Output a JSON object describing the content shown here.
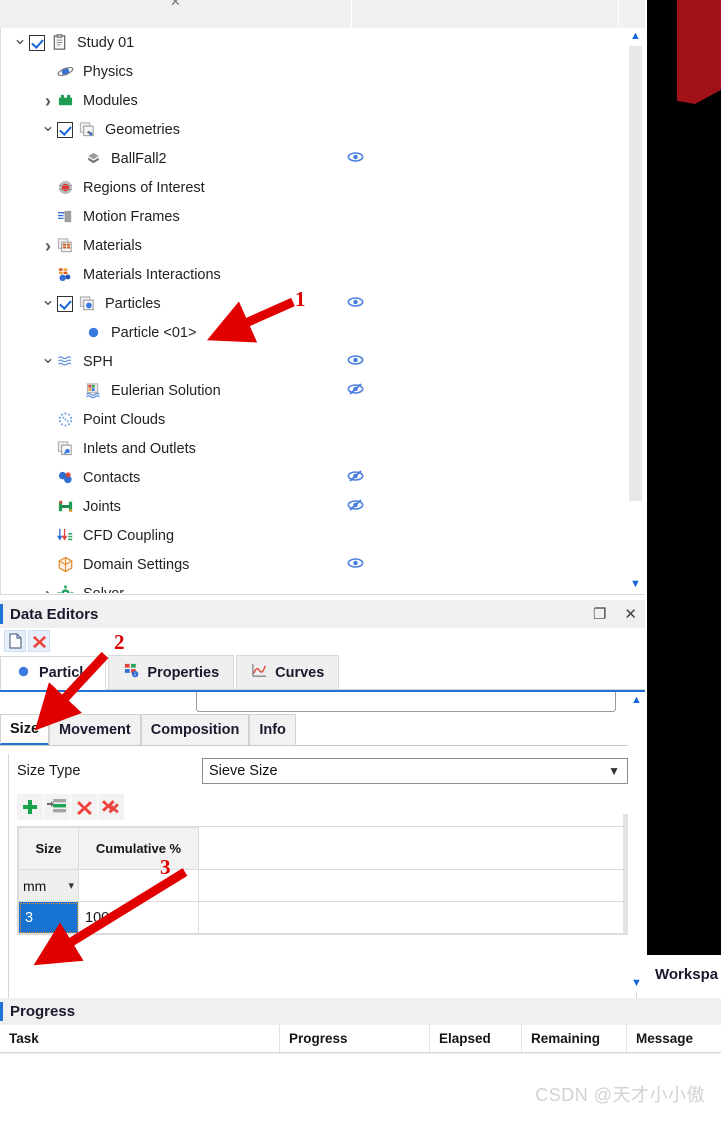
{
  "window": {
    "tab_close_icon": "close-icon"
  },
  "tree": {
    "items": [
      {
        "label": "Study 01",
        "indent": 0,
        "chevron": "down",
        "checkbox": "checked",
        "icon": "clipboard-icon",
        "eye": "none"
      },
      {
        "label": "Physics",
        "indent": 1,
        "chevron": "none",
        "checkbox": "none",
        "icon": "physics-orbit-icon",
        "eye": "none"
      },
      {
        "label": "Modules",
        "indent": 1,
        "chevron": "right",
        "checkbox": "none",
        "icon": "modules-brick-icon",
        "eye": "none"
      },
      {
        "label": "Geometries",
        "indent": 1,
        "chevron": "down",
        "checkbox": "checked",
        "icon": "geometries-icon",
        "eye": "none"
      },
      {
        "label": "BallFall2",
        "indent": 2,
        "chevron": "none",
        "checkbox": "none",
        "icon": "geometry-object-icon",
        "eye": "visible"
      },
      {
        "label": "Regions of Interest",
        "indent": 1,
        "chevron": "none",
        "checkbox": "none",
        "icon": "region-sphere-icon",
        "eye": "none"
      },
      {
        "label": "Motion Frames",
        "indent": 1,
        "chevron": "none",
        "checkbox": "none",
        "icon": "motion-frame-icon",
        "eye": "none"
      },
      {
        "label": "Materials",
        "indent": 1,
        "chevron": "right",
        "checkbox": "none",
        "icon": "materials-icon",
        "eye": "none"
      },
      {
        "label": "Materials Interactions",
        "indent": 1,
        "chevron": "none",
        "checkbox": "none",
        "icon": "materials-interactions-icon",
        "eye": "none"
      },
      {
        "label": "Particles",
        "indent": 1,
        "chevron": "down",
        "checkbox": "checked",
        "icon": "particles-icon",
        "eye": "visible"
      },
      {
        "label": "Particle <01>",
        "indent": 2,
        "chevron": "none",
        "checkbox": "none",
        "icon": "particle-dot-icon",
        "eye": "none"
      },
      {
        "label": "SPH",
        "indent": 1,
        "chevron": "down",
        "checkbox": "none",
        "icon": "sph-waves-icon",
        "eye": "visible"
      },
      {
        "label": "Eulerian Solution",
        "indent": 2,
        "chevron": "none",
        "checkbox": "none",
        "icon": "eulerian-solution-icon",
        "eye": "hidden"
      },
      {
        "label": "Point Clouds",
        "indent": 1,
        "chevron": "none",
        "checkbox": "none",
        "icon": "point-cloud-icon",
        "eye": "none"
      },
      {
        "label": "Inlets and Outlets",
        "indent": 1,
        "chevron": "none",
        "checkbox": "none",
        "icon": "inlets-outlets-icon",
        "eye": "none"
      },
      {
        "label": "Contacts",
        "indent": 1,
        "chevron": "none",
        "checkbox": "none",
        "icon": "contacts-icon",
        "eye": "hidden"
      },
      {
        "label": "Joints",
        "indent": 1,
        "chevron": "none",
        "checkbox": "none",
        "icon": "joints-icon",
        "eye": "hidden"
      },
      {
        "label": "CFD Coupling",
        "indent": 1,
        "chevron": "none",
        "checkbox": "none",
        "icon": "cfd-coupling-icon",
        "eye": "none"
      },
      {
        "label": "Domain Settings",
        "indent": 1,
        "chevron": "none",
        "checkbox": "none",
        "icon": "domain-settings-icon",
        "eye": "visible"
      },
      {
        "label": "Solver",
        "indent": 1,
        "chevron": "right",
        "checkbox": "none",
        "icon": "solver-gear-icon",
        "eye": "none"
      }
    ]
  },
  "data_editors": {
    "title": "Data Editors",
    "restore_icon": "restore-window-icon",
    "close_icon": "close-icon",
    "toolbar": [
      {
        "name": "new-document-button",
        "icon": "document-icon"
      },
      {
        "name": "delete-button",
        "icon": "red-x-icon"
      }
    ],
    "tabs": [
      {
        "label": "Particle",
        "icon": "particle-dot-icon",
        "active": true
      },
      {
        "label": "Properties",
        "icon": "properties-grid-icon",
        "active": false
      },
      {
        "label": "Curves",
        "icon": "curve-chart-icon",
        "active": false
      }
    ],
    "sub_tabs": [
      {
        "label": "Size",
        "active": true
      },
      {
        "label": "Movement",
        "active": false
      },
      {
        "label": "Composition",
        "active": false
      },
      {
        "label": "Info",
        "active": false
      }
    ],
    "size_type": {
      "label": "Size Type",
      "value": "Sieve Size"
    },
    "grid_tools": [
      {
        "name": "add-row-button",
        "icon": "green-plus-icon"
      },
      {
        "name": "insert-row-button",
        "icon": "insert-rows-icon"
      },
      {
        "name": "delete-row-button",
        "icon": "red-x-icon"
      },
      {
        "name": "delete-all-rows-button",
        "icon": "red-double-x-icon"
      }
    ],
    "grid": {
      "headers": [
        "Size",
        "Cumulative %",
        ""
      ],
      "unit_row": {
        "unit": "mm"
      },
      "rows": [
        {
          "size": "3",
          "cumulative": "100",
          "selected_cell": "size"
        }
      ]
    }
  },
  "workspace": {
    "title": "Workspa"
  },
  "progress": {
    "title": "Progress",
    "headers": [
      "Task",
      "Progress",
      "Elapsed",
      "Remaining",
      "Message"
    ],
    "rows": []
  },
  "annotations": [
    {
      "number": "1",
      "color": "#e00000"
    },
    {
      "number": "2",
      "color": "#e00000"
    },
    {
      "number": "3",
      "color": "#e00000"
    }
  ],
  "watermark": {
    "text": "CSDN @天才小小傲"
  },
  "colors": {
    "accent_blue": "#1e74d6",
    "selection_blue": "#1673d1",
    "red_annotation": "#e00000",
    "viewport_red": "#a01217"
  }
}
